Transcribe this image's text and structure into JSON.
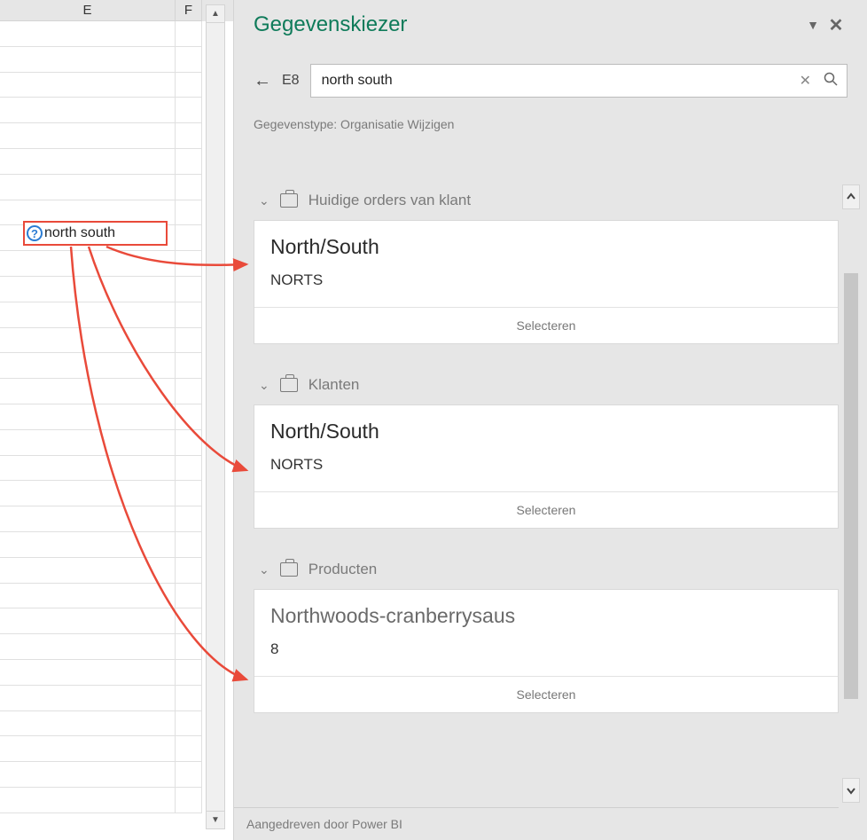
{
  "sheet": {
    "col_e": "E",
    "col_f": "F",
    "selected_cell_text": "north south"
  },
  "panel": {
    "title": "Gegevenskiezer",
    "cell_ref": "E8",
    "search_value": "north south",
    "datatype_line": "Gegevenstype: Organisatie Wijzigen",
    "footer": "Aangedreven door Power BI"
  },
  "sections": [
    {
      "label": "Huidige orders van klant",
      "card": {
        "title": "North/South",
        "sub": "NORTS",
        "select": "Selecteren",
        "gray": false
      }
    },
    {
      "label": "Klanten",
      "card": {
        "title": "North/South",
        "sub": "NORTS",
        "select": "Selecteren",
        "gray": false
      }
    },
    {
      "label": "Producten",
      "card": {
        "title": "Northwoods-cranberrysaus",
        "sub": "8",
        "select": "Selecteren",
        "gray": true
      }
    }
  ]
}
